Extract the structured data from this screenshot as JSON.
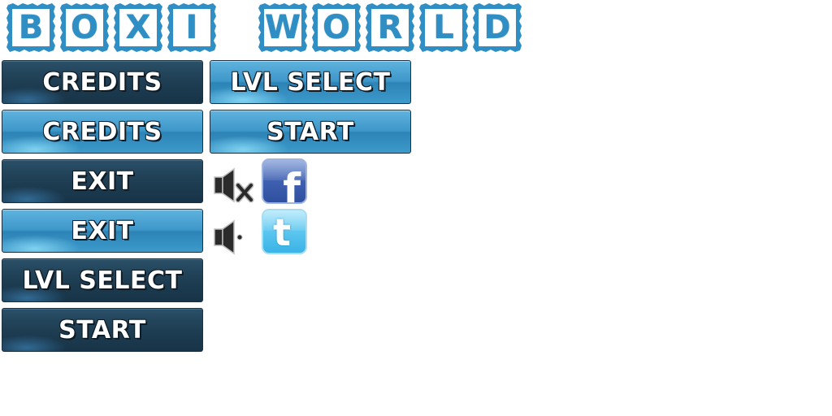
{
  "title": {
    "letters": [
      "B",
      "O",
      "X",
      "I",
      "W",
      "O",
      "R",
      "L",
      "D"
    ],
    "text": "BOXI WORLD",
    "color": "#2f8fc4"
  },
  "buttons": {
    "credits_normal": "CREDITS",
    "credits_hover": "CREDITS",
    "exit_normal": "EXIT",
    "exit_hover": "EXIT",
    "lvl_select_normal": "LVL SELECT",
    "start_normal": "START",
    "lvl_select_hover": "LVL SELECT",
    "start_hover": "START"
  },
  "icons": {
    "sound_off": "speaker-muted-icon",
    "sound_on": "speaker-icon",
    "facebook": "facebook-icon",
    "twitter": "twitter-icon"
  },
  "colors": {
    "button_dark": "#1f3f54",
    "button_light": "#3e97c9",
    "facebook": "#3f60b0",
    "twitter": "#5cc6ef"
  }
}
